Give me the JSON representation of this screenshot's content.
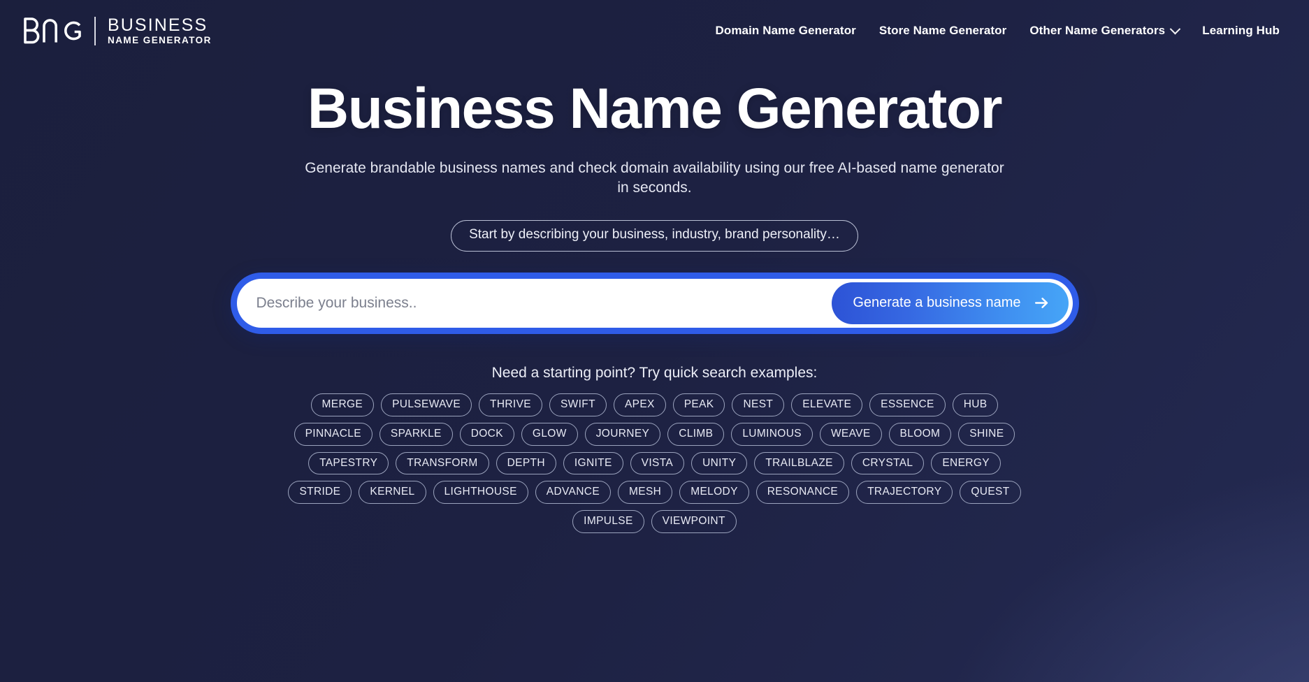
{
  "header": {
    "logo": {
      "mark": "BNG",
      "line1": "BUSINESS",
      "line2": "NAME GENERATOR"
    },
    "nav": [
      {
        "label": "Domain Name Generator",
        "has_dropdown": false
      },
      {
        "label": "Store Name Generator",
        "has_dropdown": false
      },
      {
        "label": "Other Name Generators",
        "has_dropdown": true
      },
      {
        "label": "Learning Hub",
        "has_dropdown": false
      }
    ]
  },
  "hero": {
    "title": "Business Name Generator",
    "subtitle": "Generate brandable business names and check domain availability using our free AI-based name generator in seconds.",
    "hint_pill": "Start by describing your business, industry, brand personality…"
  },
  "search": {
    "placeholder": "Describe your business..",
    "value": "",
    "button_label": "Generate a business name",
    "button_icon": "arrow-right-icon"
  },
  "examples": {
    "label": "Need a starting point? Try quick search examples:",
    "rows": [
      [
        "MERGE",
        "PULSEWAVE",
        "THRIVE",
        "SWIFT",
        "APEX",
        "PEAK",
        "NEST",
        "ELEVATE",
        "ESSENCE",
        "HUB"
      ],
      [
        "PINNACLE",
        "SPARKLE",
        "DOCK",
        "GLOW",
        "JOURNEY",
        "CLIMB",
        "LUMINOUS",
        "WEAVE",
        "BLOOM",
        "SHINE"
      ],
      [
        "TAPESTRY",
        "TRANSFORM",
        "DEPTH",
        "IGNITE",
        "VISTA",
        "UNITY",
        "TRAILBLAZE",
        "CRYSTAL",
        "ENERGY"
      ],
      [
        "STRIDE",
        "KERNEL",
        "LIGHTHOUSE",
        "ADVANCE",
        "MESH",
        "MELODY",
        "RESONANCE",
        "TRAJECTORY",
        "QUEST"
      ],
      [
        "IMPULSE",
        "VIEWPOINT"
      ]
    ]
  },
  "colors": {
    "background_dark": "#1d2142",
    "background_light": "#3d4677",
    "accent_blue": "#2f5ce8",
    "button_gradient_start": "#2d53d6",
    "button_gradient_end": "#46a5f7",
    "tag_border": "#9ba3bd",
    "text_primary": "#ffffff",
    "placeholder_text": "#7b7f8d"
  }
}
